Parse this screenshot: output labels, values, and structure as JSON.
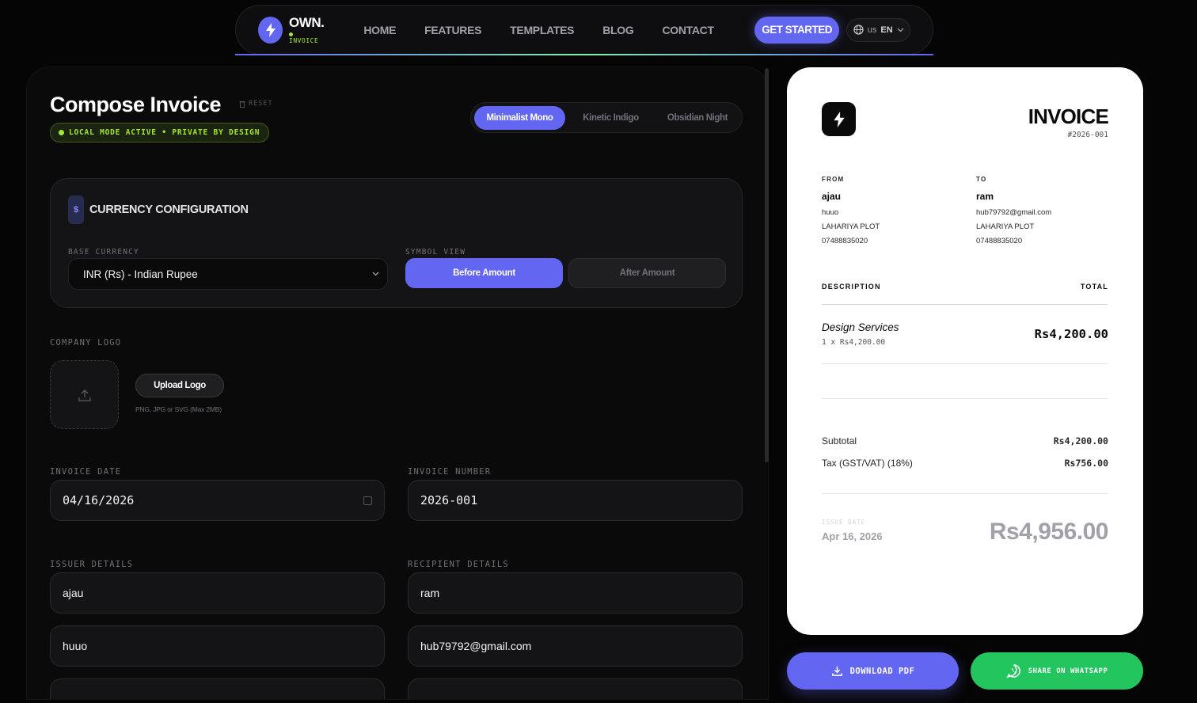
{
  "nav": {
    "brand_name": "OWN.",
    "brand_sub": "INVOICE",
    "links": [
      "HOME",
      "FEATURES",
      "TEMPLATES",
      "BLOG",
      "CONTACT"
    ],
    "cta": "GET STARTED",
    "lang_prefix": "us",
    "lang": "EN"
  },
  "composer": {
    "title": "Compose Invoice",
    "reset": "RESET",
    "status_badge": "LOCAL MODE ACTIVE • PRIVATE BY DESIGN",
    "themes": [
      "Minimalist Mono",
      "Kinetic Indigo",
      "Obsidian Night"
    ],
    "active_theme": "Minimalist Mono",
    "currency": {
      "icon_text": "$",
      "title": "CURRENCY CONFIGURATION",
      "base_label": "BASE CURRENCY",
      "base_value": "INR (Rs) - Indian Rupee",
      "symbol_label": "SYMBOL VIEW",
      "symbol_options": [
        "Before Amount",
        "After Amount"
      ],
      "symbol_selected": "Before Amount"
    },
    "logo": {
      "label": "COMPANY LOGO",
      "button": "Upload Logo",
      "hint": "PNG, JPG or SVG (Max 2MB)"
    },
    "invoice_date_label": "INVOICE DATE",
    "invoice_date": "04/16/2026",
    "invoice_number_label": "INVOICE NUMBER",
    "invoice_number": "2026-001",
    "issuer_label": "ISSUER DETAILS",
    "issuer_name": "ajau",
    "issuer_line2": "huuo",
    "recipient_label": "RECIPIENT DETAILS",
    "recipient_name": "ram",
    "recipient_email": "hub79792@gmail.com"
  },
  "preview": {
    "title": "INVOICE",
    "number": "#2026-001",
    "from_label": "FROM",
    "from": {
      "name": "ajau",
      "line1": "huuo",
      "line2": "LAHARIYA PLOT",
      "phone": "07488835020"
    },
    "to_label": "TO",
    "to": {
      "name": "ram",
      "email": "hub79792@gmail.com",
      "line2": "LAHARIYA PLOT",
      "phone": "07488835020"
    },
    "desc_header": "DESCRIPTION",
    "total_header": "TOTAL",
    "items": [
      {
        "description": "Design Services",
        "qty_line": "1 x Rs4,200.00",
        "total": "Rs4,200.00"
      }
    ],
    "subtotal_label": "Subtotal",
    "subtotal": "Rs4,200.00",
    "tax_label": "Tax (GST/VAT) (18%)",
    "tax": "Rs756.00",
    "issue_date_label": "ISSUE DATE",
    "issue_date": "Apr 16, 2026",
    "grand_total": "Rs4,956.00"
  },
  "actions": {
    "download": "DOWNLOAD PDF",
    "whatsapp": "SHARE ON WHATSAPP"
  },
  "colors": {
    "accent": "#6366f1",
    "success": "#22c55e",
    "lime": "#a3e635",
    "bg": "#050505"
  }
}
